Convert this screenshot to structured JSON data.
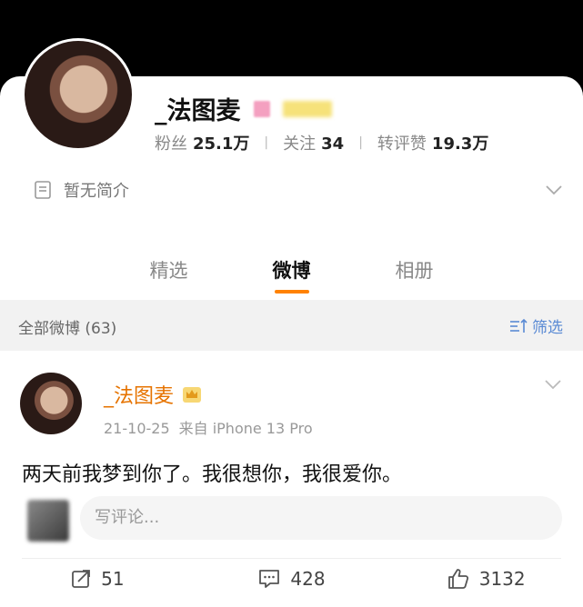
{
  "profile": {
    "name": "_法图麦",
    "stats": [
      {
        "label": "粉丝",
        "value": "25.1万"
      },
      {
        "label": "关注",
        "value": "34"
      },
      {
        "label": "转评赞",
        "value": "19.3万"
      }
    ],
    "bio": "暂无简介"
  },
  "tabs": [
    {
      "label": "精选",
      "active": false
    },
    {
      "label": "微博",
      "active": true
    },
    {
      "label": "相册",
      "active": false
    }
  ],
  "filterbar": {
    "all_label": "全部微博 (63)",
    "filter_label": "筛选"
  },
  "post": {
    "author": "_法图麦",
    "date": "21-10-25",
    "source": "来自 iPhone 13 Pro",
    "text": "两天前我梦到你了。我很想你，我很爱你。",
    "comment_placeholder": "写评论...",
    "actions": {
      "repost": "51",
      "comment": "428",
      "like": "3132"
    }
  },
  "colors": {
    "accent": "#ff8200",
    "name_orange": "#e67300",
    "filter_blue": "#5a8ad4"
  }
}
